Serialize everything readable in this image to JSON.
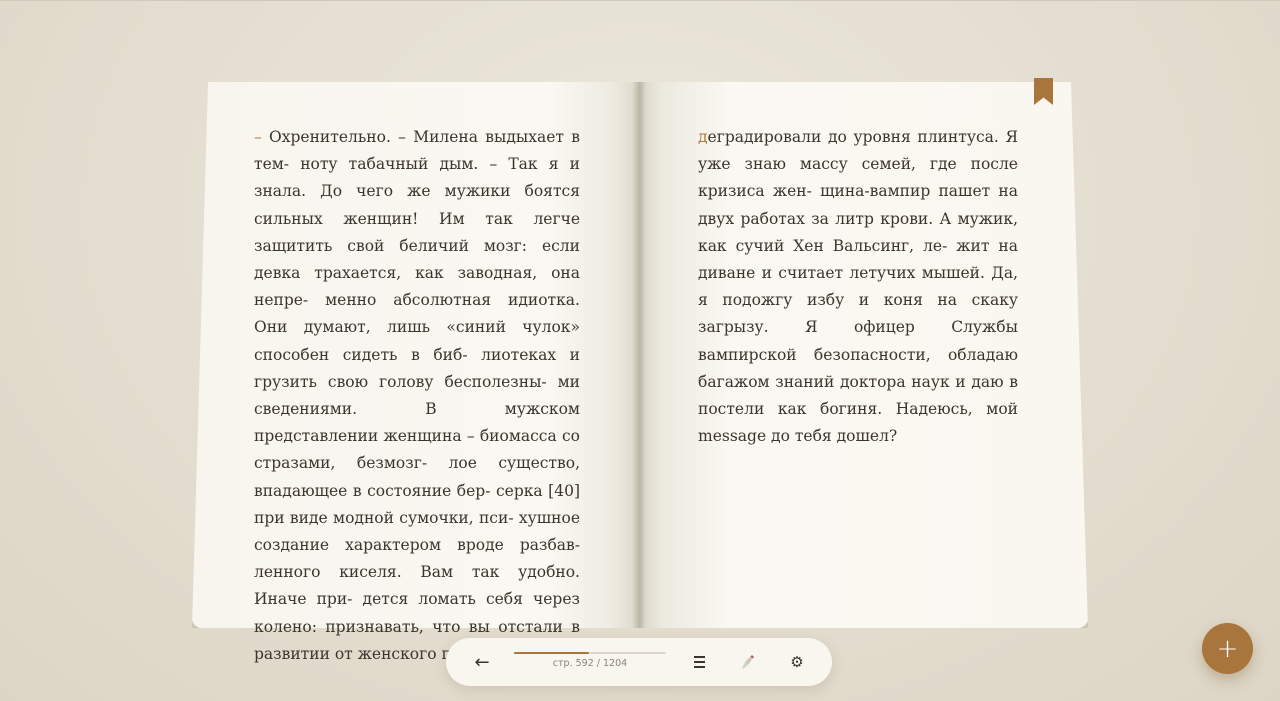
{
  "reader": {
    "left_page": {
      "lines": [
        "Охренительно. – Милена выдыхает в тем-",
        "ноту табачный дым. – Так я и знала. До чего",
        "же мужики боятся сильных женщин! Им так",
        "легче защитить свой беличий мозг: если",
        "девка трахается, как заводная, она непре-",
        "менно абсолютная идиотка. Они думают,",
        "лишь «синий чулок» способен сидеть в биб-",
        "лиотеках и грузить свою голову бесполезны-",
        "ми сведениями. В мужском представлении",
        "женщина – биомасса со стразами, безмозг-",
        "лое существо, впадающее в состояние бер-",
        "серка [40] при виде модной сумочки, пси-",
        "хушное создание характером вроде разбав-",
        "ленного киселя. Вам так удобно. Иначе при-",
        "дется ломать себя через колено: признавать,",
        "что вы отстали в развитии от женского пола,"
      ],
      "leading_dash": "–"
    },
    "right_page": {
      "drop_letter": "д",
      "lines": [
        "еградировали до уровня плинтуса. Я уже",
        "знаю массу семей, где после кризиса жен-",
        "щина-вампир пашет на двух работах за литр",
        "крови. А мужик, как сучий Хен Вальсинг, ле-",
        "жит на диване и считает летучих мышей. Да,",
        "я подожгу избу и коня на скаку загрызу. Я",
        "офицер Службы вампирской безопасности,",
        "обладаю багажом знаний доктора наук и",
        "даю в постели как богиня. Надеюсь, мой",
        "message до тебя дошел?"
      ]
    }
  },
  "toolbar": {
    "back_icon": "arrow-left-icon",
    "back_glyph": "←",
    "page_label": "стр. 592 / 1204",
    "current_page": 592,
    "total_pages": 1204,
    "menu_icon": "menu-icon",
    "brush_icon": "brush-icon",
    "settings_icon": "gear-icon",
    "settings_glyph": "⚙"
  },
  "fab": {
    "icon": "plus-icon",
    "glyph": "+"
  },
  "colors": {
    "accent": "#a8753c",
    "paper": "#f9f7f0",
    "background": "#e6e1d4",
    "text": "#3a352d"
  }
}
